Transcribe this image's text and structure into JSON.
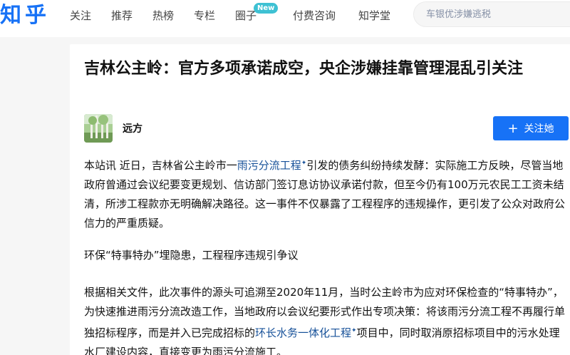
{
  "header": {
    "logo": "知乎",
    "nav": [
      "关注",
      "推荐",
      "热榜",
      "专栏",
      "圈子",
      "付费咨询",
      "知学堂"
    ],
    "badge": "New",
    "search_placeholder": "车银优涉嫌逃税"
  },
  "article": {
    "title": "吉林公主岭：官方多项承诺成空，央企涉嫌挂靠管理混乱引关注",
    "author": "远方",
    "follow_label": "关注她",
    "p1": {
      "a": "本站讯 近日，吉林省公主岭市一",
      "link": "雨污分流工程",
      "b": "引发的债务纠纷持续发酵：实际施工方反映，尽管当地政府曾通过会议纪要变更规划、信访部门签订息访协议承诺付款，但至今仍有100万元农民工工资未结清，所涉工程款亦无明确解决路径。这一事件不仅暴露了工程程序的违规操作，更引发了公众对政府公信力的严重质疑。"
    },
    "p2": "环保“特事特办”埋隐患，工程程序违规引争议",
    "p3": {
      "a": "根据相关文件，此次事件的源头可追溯至2020年11月，当时公主岭市为应对环保检查的“特事特办”，为快速推进雨污分流改造工作，当地政府以会议纪要形式作出专项决策：将该雨污分流工程不再履行单独招标程序，而是并入已完成招标的",
      "link": "环长水务一体化工程",
      "b": "项目中，同时取消原招标项目中的污水处理水厂建设内容，直接变更为雨污分流施工。"
    }
  }
}
